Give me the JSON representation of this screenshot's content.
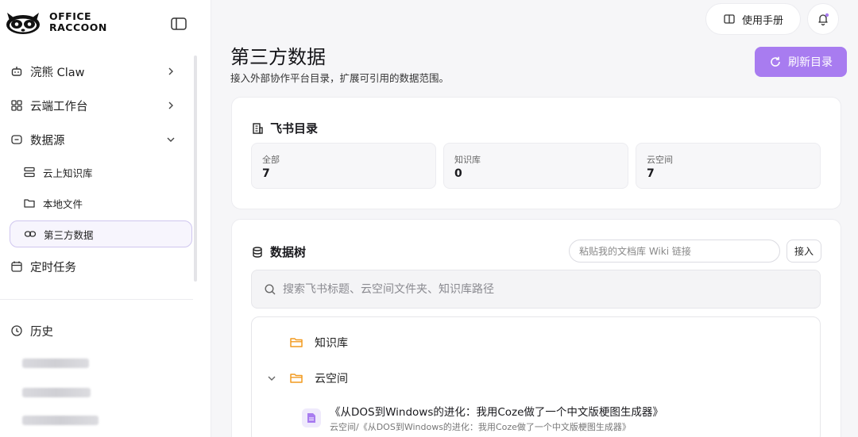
{
  "app": {
    "logo_line1": "OFFICE",
    "logo_line2": "RACCOON",
    "accent_color": "#a87cf0",
    "notification_dot_color": "#a87cf0"
  },
  "sidebar": {
    "items": [
      {
        "label": "浣熊 Claw",
        "icon": "robot-icon",
        "chevron": "right"
      },
      {
        "label": "云端工作台",
        "icon": "grid-icon",
        "chevron": "right"
      },
      {
        "label": "数据源",
        "icon": "database-icon",
        "chevron": "down"
      }
    ],
    "sub_items": [
      {
        "label": "云上知识库",
        "icon": "knowledge-icon"
      },
      {
        "label": "本地文件",
        "icon": "folder-icon"
      },
      {
        "label": "第三方数据",
        "icon": "link-icon",
        "active": true
      }
    ],
    "scheduled": {
      "label": "定时任务",
      "icon": "calendar-icon"
    },
    "history": {
      "label": "历史",
      "icon": "history-icon"
    }
  },
  "header": {
    "manual_label": "使用手册",
    "title": "第三方数据",
    "subtitle": "接入外部协作平台目录，扩展可引用的数据范围。",
    "refresh_label": "刷新目录"
  },
  "feishu": {
    "title": "飞书目录",
    "stats": [
      {
        "label": "全部",
        "value": "7"
      },
      {
        "label": "知识库",
        "value": "0"
      },
      {
        "label": "云空间",
        "value": "7"
      }
    ]
  },
  "datatree": {
    "title": "数据树",
    "wiki_placeholder": "粘贴我的文档库 Wiki 链接",
    "connect_label": "接入",
    "search_placeholder": "搜索飞书标题、云空间文件夹、知识库路径",
    "nodes": [
      {
        "label": "知识库",
        "expanded": false
      },
      {
        "label": "云空间",
        "expanded": true
      }
    ],
    "doc": {
      "title": "《从DOS到Windows的进化：我用Coze做了一个中文版梗图生成器》",
      "path": "云空间/《从DOS到Windows的进化：我用Coze做了一个中文版梗图生成器》"
    }
  }
}
